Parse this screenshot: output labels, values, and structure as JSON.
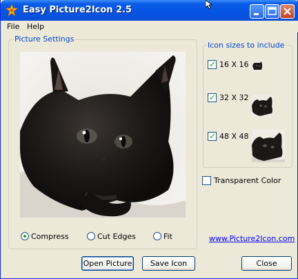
{
  "window": {
    "title": "Easy Picture2Icon 2.5"
  },
  "menu": [
    {
      "label": "File"
    },
    {
      "label": "Help"
    }
  ],
  "picture_settings": {
    "title": "Picture Settings",
    "modes": [
      {
        "label": "Compress",
        "selected": true
      },
      {
        "label": "Cut Edges",
        "selected": false
      },
      {
        "label": "Fit",
        "selected": false
      }
    ]
  },
  "icon_sizes": {
    "title": "Icon sizes to include",
    "sizes": [
      {
        "label": "16 X 16",
        "checked": true
      },
      {
        "label": "32 X 32",
        "checked": true
      },
      {
        "label": "48 X 48",
        "checked": true
      }
    ]
  },
  "transparent": {
    "label": "Transparent Color",
    "checked": false
  },
  "link": {
    "label": "www.Picture2Icon.com"
  },
  "buttons": {
    "open": "Open Picture",
    "save": "Save Icon",
    "close": "Close"
  },
  "colors": {
    "title_bar": "#0554e3",
    "group_title": "#0046d5",
    "link": "#0000ff",
    "background": "#ece9d8"
  }
}
